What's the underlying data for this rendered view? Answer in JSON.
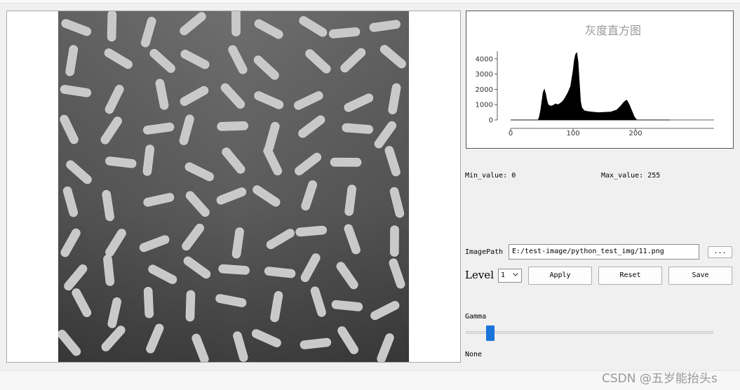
{
  "histogram": {
    "title": "灰度直方图",
    "chart_data": {
      "type": "area",
      "title": "灰度直方图",
      "xlabel": "",
      "ylabel": "",
      "xlim": [
        0,
        255
      ],
      "ylim": [
        0,
        4500
      ],
      "xticks": [
        0,
        100,
        200
      ],
      "yticks": [
        0,
        1000,
        2000,
        3000,
        4000
      ],
      "x": [
        0,
        44,
        46,
        48,
        50,
        52,
        54,
        56,
        58,
        60,
        64,
        68,
        72,
        76,
        80,
        84,
        88,
        92,
        96,
        100,
        102,
        104,
        106,
        108,
        110,
        112,
        114,
        118,
        124,
        130,
        140,
        150,
        160,
        170,
        176,
        182,
        186,
        190,
        194,
        198,
        202,
        255
      ],
      "y": [
        0,
        0,
        200,
        600,
        1200,
        1800,
        2000,
        1700,
        1300,
        1000,
        900,
        950,
        1050,
        1000,
        1100,
        1250,
        1500,
        1800,
        2200,
        3200,
        3900,
        4300,
        4400,
        3800,
        2500,
        1200,
        800,
        600,
        550,
        520,
        480,
        500,
        520,
        650,
        900,
        1200,
        1300,
        1000,
        600,
        200,
        0,
        0
      ]
    }
  },
  "stats": {
    "min_label": "Min_value: 0",
    "max_label": "Max_value: 255"
  },
  "imagepath": {
    "label": "ImagePath",
    "value": "E:/test-image/python_test_img/11.png",
    "browse_label": "..."
  },
  "level": {
    "label": "Level",
    "selected": "1"
  },
  "buttons": {
    "apply": "Apply",
    "reset": "Reset",
    "save": "Save"
  },
  "gamma": {
    "label": "Gamma",
    "value_fraction": 0.06,
    "value_text": "None"
  },
  "watermark": "CSDN @五岁能抬头s"
}
